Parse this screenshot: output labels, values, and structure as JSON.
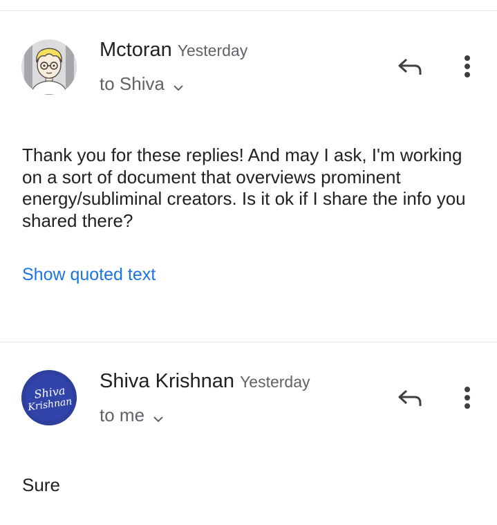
{
  "messages": [
    {
      "sender": "Mctoran",
      "time": "Yesterday",
      "recipient": "to Shiva",
      "avatar": "cartoon-avatar",
      "body": "Thank you for these replies! And may I ask, I'm working on a  sort of document that overviews prominent energy/subliminal creators. Is it ok if I share the info you shared there?",
      "quoted_link": "Show quoted text"
    },
    {
      "sender": "Shiva Krishnan",
      "time": "Yesterday",
      "recipient": "to me",
      "avatar_text_line1": "Shiva",
      "avatar_text_line2": "Krishnan",
      "avatar_color": "#2e3f9e",
      "body": "Sure"
    }
  ],
  "icons": {
    "reply": "reply-icon",
    "more": "more-vert-icon",
    "expand": "chevron-down-icon"
  },
  "colors": {
    "link": "#1a73e8",
    "secondary_text": "#5f6368"
  }
}
